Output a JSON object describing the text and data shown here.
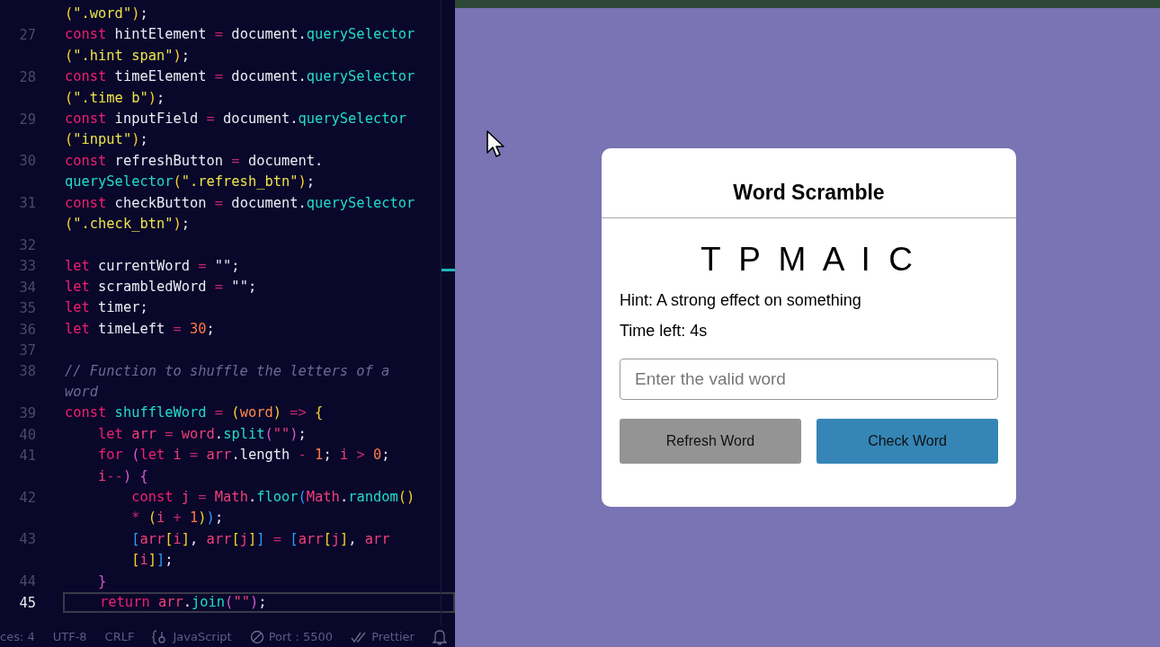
{
  "editor": {
    "lines": [
      {
        "tokens": [
          {
            "kind": "p1",
            "text": "("
          },
          {
            "kind": "str",
            "text": "\".word\""
          },
          {
            "kind": "p1",
            "text": ")"
          },
          {
            "kind": "id",
            "text": ";"
          }
        ]
      },
      {
        "number": "27",
        "tokens": [
          {
            "kind": "kw",
            "text": "const "
          },
          {
            "kind": "id",
            "text": "hintElement "
          },
          {
            "kind": "op",
            "text": "= "
          },
          {
            "kind": "id",
            "text": "document."
          },
          {
            "kind": "fn",
            "text": "querySelector"
          }
        ]
      },
      {
        "tokens": [
          {
            "kind": "p1",
            "text": "("
          },
          {
            "kind": "str",
            "text": "\".hint span\""
          },
          {
            "kind": "p1",
            "text": ")"
          },
          {
            "kind": "id",
            "text": ";"
          }
        ]
      },
      {
        "number": "28",
        "tokens": [
          {
            "kind": "kw",
            "text": "const "
          },
          {
            "kind": "id",
            "text": "timeElement "
          },
          {
            "kind": "op",
            "text": "= "
          },
          {
            "kind": "id",
            "text": "document."
          },
          {
            "kind": "fn",
            "text": "querySelector"
          }
        ]
      },
      {
        "tokens": [
          {
            "kind": "p1",
            "text": "("
          },
          {
            "kind": "str",
            "text": "\".time b\""
          },
          {
            "kind": "p1",
            "text": ")"
          },
          {
            "kind": "id",
            "text": ";"
          }
        ]
      },
      {
        "number": "29",
        "tokens": [
          {
            "kind": "kw",
            "text": "const "
          },
          {
            "kind": "id",
            "text": "inputField "
          },
          {
            "kind": "op",
            "text": "= "
          },
          {
            "kind": "id",
            "text": "document."
          },
          {
            "kind": "fn",
            "text": "querySelector"
          }
        ]
      },
      {
        "tokens": [
          {
            "kind": "p1",
            "text": "("
          },
          {
            "kind": "str",
            "text": "\"input\""
          },
          {
            "kind": "p1",
            "text": ")"
          },
          {
            "kind": "id",
            "text": ";"
          }
        ]
      },
      {
        "number": "30",
        "tokens": [
          {
            "kind": "kw",
            "text": "const "
          },
          {
            "kind": "id",
            "text": "refreshButton "
          },
          {
            "kind": "op",
            "text": "= "
          },
          {
            "kind": "id",
            "text": "document."
          }
        ]
      },
      {
        "tokens": [
          {
            "kind": "fn",
            "text": "querySelector"
          },
          {
            "kind": "p1",
            "text": "("
          },
          {
            "kind": "str",
            "text": "\".refresh_btn\""
          },
          {
            "kind": "p1",
            "text": ")"
          },
          {
            "kind": "id",
            "text": ";"
          }
        ]
      },
      {
        "number": "31",
        "tokens": [
          {
            "kind": "kw",
            "text": "const "
          },
          {
            "kind": "id",
            "text": "checkButton "
          },
          {
            "kind": "op",
            "text": "= "
          },
          {
            "kind": "id",
            "text": "document."
          },
          {
            "kind": "fn",
            "text": "querySelector"
          }
        ]
      },
      {
        "tokens": [
          {
            "kind": "p1",
            "text": "("
          },
          {
            "kind": "str",
            "text": "\".check_btn\""
          },
          {
            "kind": "p1",
            "text": ")"
          },
          {
            "kind": "id",
            "text": ";"
          }
        ]
      },
      {
        "number": "32"
      },
      {
        "number": "33",
        "tokens": [
          {
            "kind": "kw",
            "text": "let "
          },
          {
            "kind": "id",
            "text": "currentWord "
          },
          {
            "kind": "op",
            "text": "= "
          },
          {
            "kind": "id",
            "text": "\"\";"
          }
        ]
      },
      {
        "number": "34",
        "tokens": [
          {
            "kind": "kw",
            "text": "let "
          },
          {
            "kind": "id",
            "text": "scrambledWord "
          },
          {
            "kind": "op",
            "text": "= "
          },
          {
            "kind": "id",
            "text": "\"\";"
          }
        ]
      },
      {
        "number": "35",
        "tokens": [
          {
            "kind": "kw",
            "text": "let "
          },
          {
            "kind": "id",
            "text": "timer;"
          }
        ]
      },
      {
        "number": "36",
        "tokens": [
          {
            "kind": "kw",
            "text": "let "
          },
          {
            "kind": "id",
            "text": "timeLeft "
          },
          {
            "kind": "op",
            "text": "= "
          },
          {
            "kind": "num",
            "text": "30"
          },
          {
            "kind": "id",
            "text": ";"
          }
        ]
      },
      {
        "number": "37"
      },
      {
        "number": "38",
        "tokens": [
          {
            "kind": "com",
            "text": "// Function to shuffle the letters of a"
          }
        ]
      },
      {
        "tokens": [
          {
            "kind": "com",
            "text": "word"
          }
        ]
      },
      {
        "number": "39",
        "tokens": [
          {
            "kind": "kw",
            "text": "const "
          },
          {
            "kind": "fn",
            "text": "shuffleWord "
          },
          {
            "kind": "op",
            "text": "= "
          },
          {
            "kind": "p1",
            "text": "("
          },
          {
            "kind": "param",
            "text": "word"
          },
          {
            "kind": "p1",
            "text": ")"
          },
          {
            "kind": "op",
            "text": " => "
          },
          {
            "kind": "p1",
            "text": "{"
          }
        ]
      },
      {
        "number": "40",
        "tokens": [
          {
            "kind": "kw",
            "text": "    let "
          },
          {
            "kind": "var",
            "text": "arr "
          },
          {
            "kind": "op",
            "text": "= "
          },
          {
            "kind": "var",
            "text": "word"
          },
          {
            "kind": "id",
            "text": "."
          },
          {
            "kind": "fn",
            "text": "split"
          },
          {
            "kind": "p2",
            "text": "("
          },
          {
            "kind": "var",
            "text": "\"\""
          },
          {
            "kind": "p2",
            "text": ")"
          },
          {
            "kind": "id",
            "text": ";"
          }
        ]
      },
      {
        "number": "41",
        "tokens": [
          {
            "kind": "kw",
            "text": "    for "
          },
          {
            "kind": "p2",
            "text": "("
          },
          {
            "kind": "kw",
            "text": "let "
          },
          {
            "kind": "var",
            "text": "i "
          },
          {
            "kind": "op",
            "text": "= "
          },
          {
            "kind": "var",
            "text": "arr"
          },
          {
            "kind": "id",
            "text": ".length "
          },
          {
            "kind": "op",
            "text": "- "
          },
          {
            "kind": "num",
            "text": "1"
          },
          {
            "kind": "id",
            "text": "; "
          },
          {
            "kind": "var",
            "text": "i "
          },
          {
            "kind": "op",
            "text": "> "
          },
          {
            "kind": "num",
            "text": "0"
          },
          {
            "kind": "id",
            "text": ";"
          }
        ]
      },
      {
        "tokens": [
          {
            "kind": "var",
            "text": "    i"
          },
          {
            "kind": "op",
            "text": "--"
          },
          {
            "kind": "p2",
            "text": ")"
          },
          {
            "kind": "p2",
            "text": " {"
          }
        ]
      },
      {
        "number": "42",
        "tokens": [
          {
            "kind": "kw",
            "text": "        const "
          },
          {
            "kind": "var",
            "text": "j "
          },
          {
            "kind": "op",
            "text": "= "
          },
          {
            "kind": "var",
            "text": "Math"
          },
          {
            "kind": "id",
            "text": "."
          },
          {
            "kind": "fn",
            "text": "floor"
          },
          {
            "kind": "p3",
            "text": "("
          },
          {
            "kind": "var",
            "text": "Math"
          },
          {
            "kind": "id",
            "text": "."
          },
          {
            "kind": "fn",
            "text": "random"
          },
          {
            "kind": "p1",
            "text": "()"
          }
        ]
      },
      {
        "tokens": [
          {
            "kind": "op",
            "text": "        * "
          },
          {
            "kind": "p1",
            "text": "("
          },
          {
            "kind": "var",
            "text": "i "
          },
          {
            "kind": "op",
            "text": "+ "
          },
          {
            "kind": "num",
            "text": "1"
          },
          {
            "kind": "p1",
            "text": ")"
          },
          {
            "kind": "p3",
            "text": ")"
          },
          {
            "kind": "id",
            "text": ";"
          }
        ]
      },
      {
        "number": "43",
        "tokens": [
          {
            "kind": "p3",
            "text": "        ["
          },
          {
            "kind": "var",
            "text": "arr"
          },
          {
            "kind": "p1",
            "text": "["
          },
          {
            "kind": "var",
            "text": "i"
          },
          {
            "kind": "p1",
            "text": "]"
          },
          {
            "kind": "id",
            "text": ", "
          },
          {
            "kind": "var",
            "text": "arr"
          },
          {
            "kind": "p1",
            "text": "["
          },
          {
            "kind": "var",
            "text": "j"
          },
          {
            "kind": "p1",
            "text": "]"
          },
          {
            "kind": "p3",
            "text": "]"
          },
          {
            "kind": "op",
            "text": " = "
          },
          {
            "kind": "p3",
            "text": "["
          },
          {
            "kind": "var",
            "text": "arr"
          },
          {
            "kind": "p1",
            "text": "["
          },
          {
            "kind": "var",
            "text": "j"
          },
          {
            "kind": "p1",
            "text": "]"
          },
          {
            "kind": "id",
            "text": ", "
          },
          {
            "kind": "var",
            "text": "arr"
          }
        ]
      },
      {
        "tokens": [
          {
            "kind": "p1",
            "text": "        ["
          },
          {
            "kind": "var",
            "text": "i"
          },
          {
            "kind": "p1",
            "text": "]"
          },
          {
            "kind": "p3",
            "text": "]"
          },
          {
            "kind": "id",
            "text": ";"
          }
        ]
      },
      {
        "number": "44",
        "tokens": [
          {
            "kind": "p2",
            "text": "    }"
          }
        ]
      },
      {
        "number": "45",
        "current": true,
        "tokens": [
          {
            "kind": "kw",
            "text": "    return "
          },
          {
            "kind": "var",
            "text": "arr"
          },
          {
            "kind": "id",
            "text": "."
          },
          {
            "kind": "fn",
            "text": "join"
          },
          {
            "kind": "p2",
            "text": "("
          },
          {
            "kind": "var",
            "text": "\"\""
          },
          {
            "kind": "p2",
            "text": ")"
          },
          {
            "kind": "id",
            "text": ";"
          }
        ]
      }
    ]
  },
  "status_bar": [
    {
      "kind": "text",
      "text": "ces: 4"
    },
    {
      "kind": "text",
      "text": "UTF-8"
    },
    {
      "kind": "text",
      "text": "CRLF"
    },
    {
      "kind": "language",
      "text": "JavaScript"
    },
    {
      "kind": "port",
      "text": "Port : 5500"
    },
    {
      "kind": "formatter",
      "text": "Prettier"
    },
    {
      "kind": "bell"
    }
  ],
  "game": {
    "title": "Word Scramble",
    "scrambled_word": "T P M A I C",
    "hint": "Hint: A strong effect on something",
    "time": "Time left: 4s",
    "input": {
      "placeholder": "Enter the valid word"
    },
    "buttons": [
      {
        "kind": "refresh",
        "label": "Refresh Word"
      },
      {
        "kind": "check",
        "label": "Check Word"
      }
    ]
  }
}
